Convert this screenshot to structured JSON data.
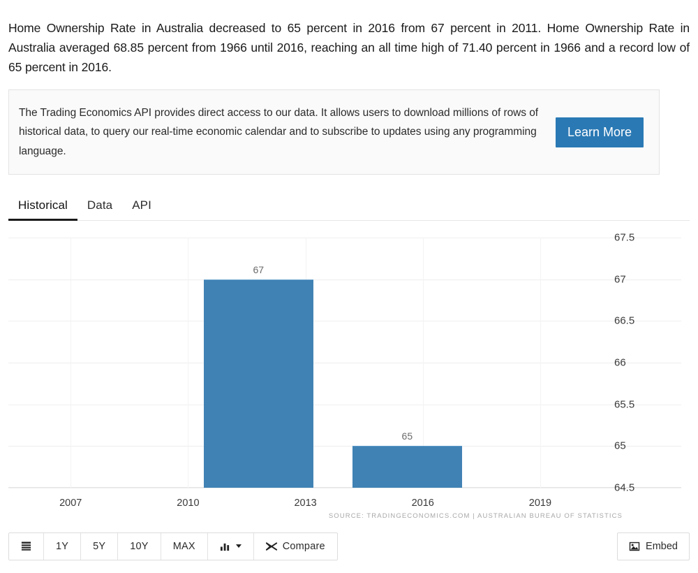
{
  "intro": {
    "paragraph": "Home Ownership Rate in Australia decreased to 65 percent in 2016 from 67 percent in 2011. Home Ownership Rate in Australia averaged 68.85 percent from 1966 until 2016, reaching an all time high of 71.40 percent in 1966 and a record low of 65 percent in 2016."
  },
  "api_banner": {
    "text": "The Trading Economics API provides direct access to our data. It allows users to download millions of rows of historical data, to query our real-time economic calendar and to subscribe to updates using any programming language.",
    "button_label": "Learn More",
    "button_color": "#2a79b4"
  },
  "tabs": [
    {
      "label": "Historical",
      "active": true
    },
    {
      "label": "Data",
      "active": false
    },
    {
      "label": "API",
      "active": false
    }
  ],
  "chart_data": {
    "type": "bar",
    "title": "",
    "xlabel": "",
    "ylabel": "",
    "categories": [
      "2011",
      "2016"
    ],
    "values": [
      67,
      65
    ],
    "bar_labels": [
      "67",
      "65"
    ],
    "bar_color": "#4182b4",
    "ylim": [
      64.5,
      67.5
    ],
    "yticks": [
      67.5,
      67,
      66.5,
      66,
      65.5,
      65,
      64.5
    ],
    "ytick_labels": [
      "67.5",
      "67",
      "66.5",
      "66",
      "65.5",
      "65",
      "64.5"
    ],
    "xticks": [
      2007,
      2010,
      2013,
      2016,
      2019
    ],
    "xtick_labels": [
      "2007",
      "2010",
      "2013",
      "2016",
      "2019"
    ],
    "xlim": [
      2005.8,
      2020.5
    ],
    "bar_spans": [
      {
        "start": 2010.4,
        "end": 2013.2
      },
      {
        "start": 2014.2,
        "end": 2017.0
      }
    ],
    "grid": true,
    "legend": false,
    "source": "SOURCE: TRADINGECONOMICS.COM | AUSTRALIAN BUREAU OF STATISTICS"
  },
  "toolbar": {
    "list_icon": "list-icon",
    "ranges": [
      "1Y",
      "5Y",
      "10Y",
      "MAX"
    ],
    "chart_type_icon": "bar-chart-icon",
    "compare_icon": "shuffle-icon",
    "compare_label": "Compare",
    "embed_icon": "image-icon",
    "embed_label": "Embed"
  }
}
